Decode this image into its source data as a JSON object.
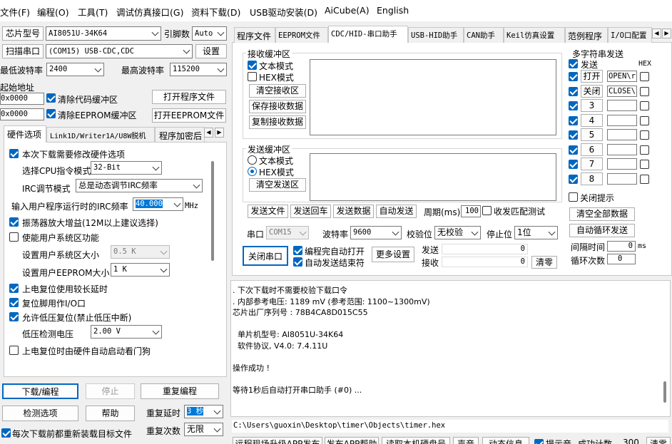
{
  "menu": [
    "文件(F)",
    "编程(O)",
    "工具(T)",
    "调试仿真接口(G)",
    "资料下载(D)",
    "USB驱动安装(D)",
    "AiCube(A)",
    "English"
  ],
  "left": {
    "chip_label": "芯片型号",
    "chip_value": "AI8051U-34K64",
    "engine_label": "引脚数",
    "engine_value": "Auto",
    "scan_label": "扫描串口",
    "port_value": "(COM15) USB-CDC,CDC",
    "settings_label": "设置",
    "min_baud_label": "最低波特率",
    "min_baud_value": "2400",
    "max_baud_label": "最高波特率",
    "max_baud_value": "115200",
    "start_addr_label": "起始地址",
    "addr1": "0x0000",
    "clear_code_label": "清除代码缓冲区",
    "open_prog_label": "打开程序文件",
    "addr2": "0x0000",
    "clear_eeprom_label": "清除EEPROM缓冲区",
    "open_eeprom_label": "打开EEPROM文件",
    "tabs": [
      "硬件选项",
      "Link1D/Writer1A/U8W脱机",
      "程序加密后"
    ],
    "hw": {
      "reset_hw": "本次下载需要修改硬件选项",
      "cpu_mode_label": "选择CPU指令模式",
      "cpu_mode_value": "32-Bit",
      "irc_label": "IRC调节模式",
      "irc_value": "总是动态调节IRC频率",
      "freq_label": "输入用户程序运行时的IRC频率",
      "freq_value": "40.000",
      "freq_unit": "MHz",
      "osc": "振荡器放大增益(12M以上建议选择)",
      "user_sys": "使能用户系统区功能",
      "user_sys_size_label": "设置用户系统区大小",
      "user_sys_size_value": "0.5 K",
      "eeprom_size_label": "设置用户EEPROM大小",
      "eeprom_size_value": "1   K",
      "power_reset": "上电复位使用较长延时",
      "reset_io": "复位脚用作I/O口",
      "lvr": "允许低压复位(禁止低压中断)",
      "lvd_label": "低压检测电压",
      "lvd_value": "2.00 V",
      "wdt": "上电复位时由硬件自动启动看门狗"
    },
    "download_label": "下载/编程",
    "stop_label": "停止",
    "reprogram_label": "重复编程",
    "detect_label": "检测选项",
    "help_label": "帮助",
    "delay_label": "重复延时",
    "delay_value": "3 秒",
    "reload_label": "每次下载前都重新装载目标文件",
    "count_label": "重复次数",
    "count_value": "无限"
  },
  "right": {
    "tabs": [
      "程序文件",
      "EEPROM文件",
      "CDC/HID-串口助手",
      "USB-HID助手",
      "CAN助手",
      "Keil仿真设置",
      "范例程序",
      "I/O口配置"
    ],
    "rx": {
      "title": "接收缓冲区",
      "text_mode": "文本模式",
      "hex_mode": "HEX模式",
      "clear": "清空接收区",
      "save": "保存接收数据",
      "copy": "复制接收数据"
    },
    "tx": {
      "title": "发送缓冲区",
      "text_mode": "文本模式",
      "hex_mode": "HEX模式",
      "clear": "清空发送区"
    },
    "send_file": "发送文件",
    "send_enter": "发送回车",
    "send_data": "发送数据",
    "auto_send": "自动发送",
    "period_label": "周期(ms)",
    "period_value": "100",
    "recv_match": "收发匹配测试",
    "port_label": "串口",
    "port_value": "COM15",
    "baud_label": "波特率",
    "baud_value": "9600",
    "parity_label": "校验位",
    "parity_value": "无校验",
    "stop_label": "停止位",
    "stop_value": "1位",
    "close_port": "关闭串口",
    "auto_open": "编程完自动打开",
    "auto_end": "自动发送结束符",
    "more": "更多设置",
    "send_label": "发送",
    "send_count": "0",
    "recv_label": "接收",
    "recv_count": "0",
    "clear_count": "清零",
    "multi": {
      "title": "多字符串发送",
      "hex": "HEX",
      "send": "发送",
      "rows": [
        {
          "label": "打开",
          "value": "OPEN\\r"
        },
        {
          "label": "关闭",
          "value": "CLOSE\\"
        },
        {
          "label": "3",
          "value": ""
        },
        {
          "label": "4",
          "value": ""
        },
        {
          "label": "5",
          "value": ""
        },
        {
          "label": "6",
          "value": ""
        },
        {
          "label": "7",
          "value": ""
        },
        {
          "label": "8",
          "value": ""
        }
      ],
      "close_tip": "关闭提示",
      "clear_all": "清空全部数据",
      "auto_loop": "自动循环发送",
      "interval_label": "间隔时间",
      "interval_value": "0",
      "interval_unit": "ms",
      "loop_label": "循环次数",
      "loop_value": "0"
    }
  },
  "log": [
    ". 下次下载时不需要校验下载口令",
    ". 内部参考电压: 1189 mV (参考范围: 1100~1300mV)",
    "芯片出厂序列号 : 78B4CA8D015C55",
    "",
    "  单片机型号: AI8051U-34K64",
    "  软件协议, V4.0: 7.4.11U",
    "",
    "操作成功 !",
    "",
    "等待1秒后自动打开串口助手 (#0) ..."
  ],
  "filepath": "C:\\Users\\guoxin\\Desktop\\timer\\Objects\\timer.hex",
  "bottom": [
    "远程现场升级APP发布",
    "发布APP帮助",
    "读取本机硬盘号",
    "声音",
    "动态信息",
    "提示音",
    "成功计数",
    "300",
    "清零"
  ]
}
